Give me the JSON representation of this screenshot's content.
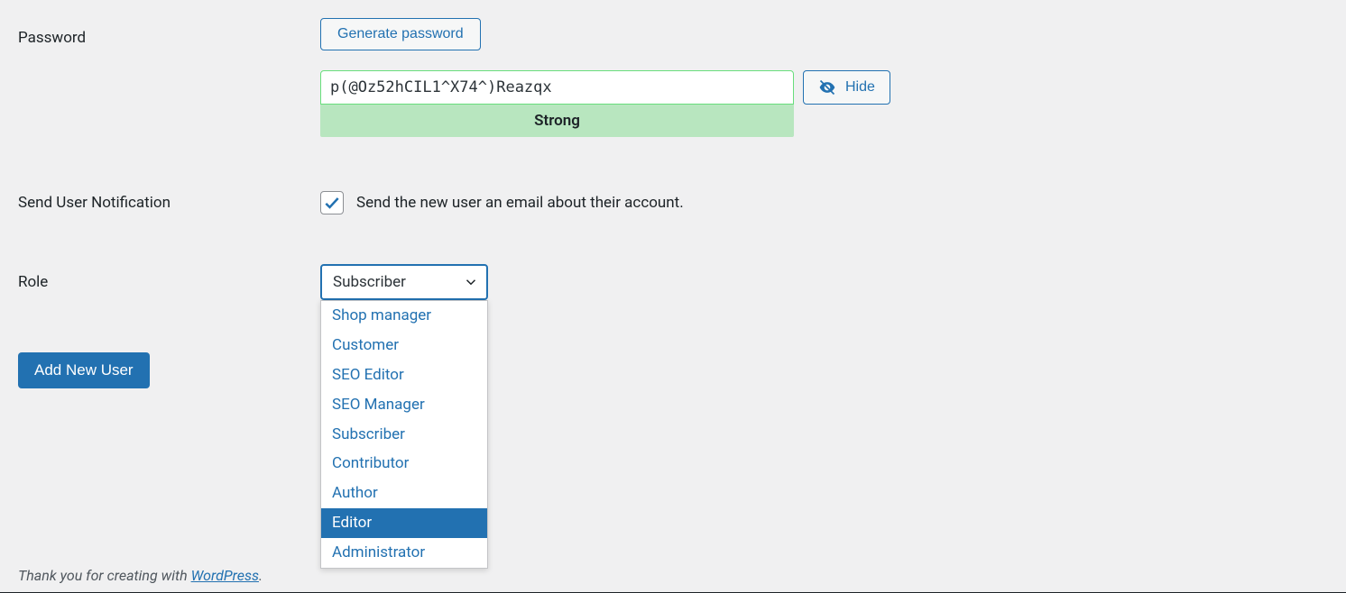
{
  "password": {
    "label": "Password",
    "generate_button": "Generate password",
    "value": "p(@Oz52hCIL1^X74^)Reazqx",
    "strength": "Strong",
    "hide_button": "Hide"
  },
  "notification": {
    "label": "Send User Notification",
    "description": "Send the new user an email about their account.",
    "checked": true
  },
  "role": {
    "label": "Role",
    "selected": "Subscriber",
    "options": [
      {
        "label": "Shop manager",
        "highlighted": false
      },
      {
        "label": "Customer",
        "highlighted": false
      },
      {
        "label": "SEO Editor",
        "highlighted": false
      },
      {
        "label": "SEO Manager",
        "highlighted": false
      },
      {
        "label": "Subscriber",
        "highlighted": false
      },
      {
        "label": "Contributor",
        "highlighted": false
      },
      {
        "label": "Author",
        "highlighted": false
      },
      {
        "label": "Editor",
        "highlighted": true
      },
      {
        "label": "Administrator",
        "highlighted": false
      }
    ]
  },
  "submit": {
    "label": "Add New User"
  },
  "footer": {
    "prefix": "Thank you for creating with ",
    "link_text": "WordPress",
    "suffix": "."
  }
}
